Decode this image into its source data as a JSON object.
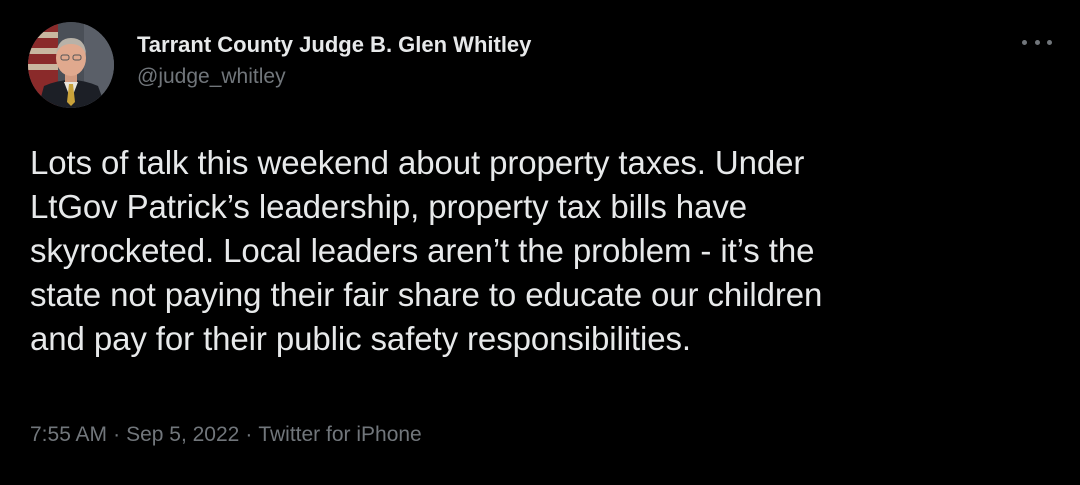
{
  "author": {
    "display_name": "Tarrant County Judge B. Glen Whitley",
    "handle": "@judge_whitley",
    "avatar_icon": "profile-photo"
  },
  "more_menu_icon": "more-horizontal-icon",
  "tweet": {
    "text_lines": [
      "Lots of talk this weekend about property taxes. Under",
      "LtGov Patrick’s leadership, property tax bills have",
      "skyrocketed. Local leaders aren’t the problem - it’s the",
      "state not paying their fair share to educate our children",
      "and pay for their public safety responsibilities."
    ]
  },
  "meta": {
    "time": "7:55 AM",
    "separator": "·",
    "date": "Sep 5, 2022",
    "source": "Twitter for iPhone"
  },
  "colors": {
    "background": "#000000",
    "primary_text": "#e7e9ea",
    "secondary_text": "#71767b"
  }
}
